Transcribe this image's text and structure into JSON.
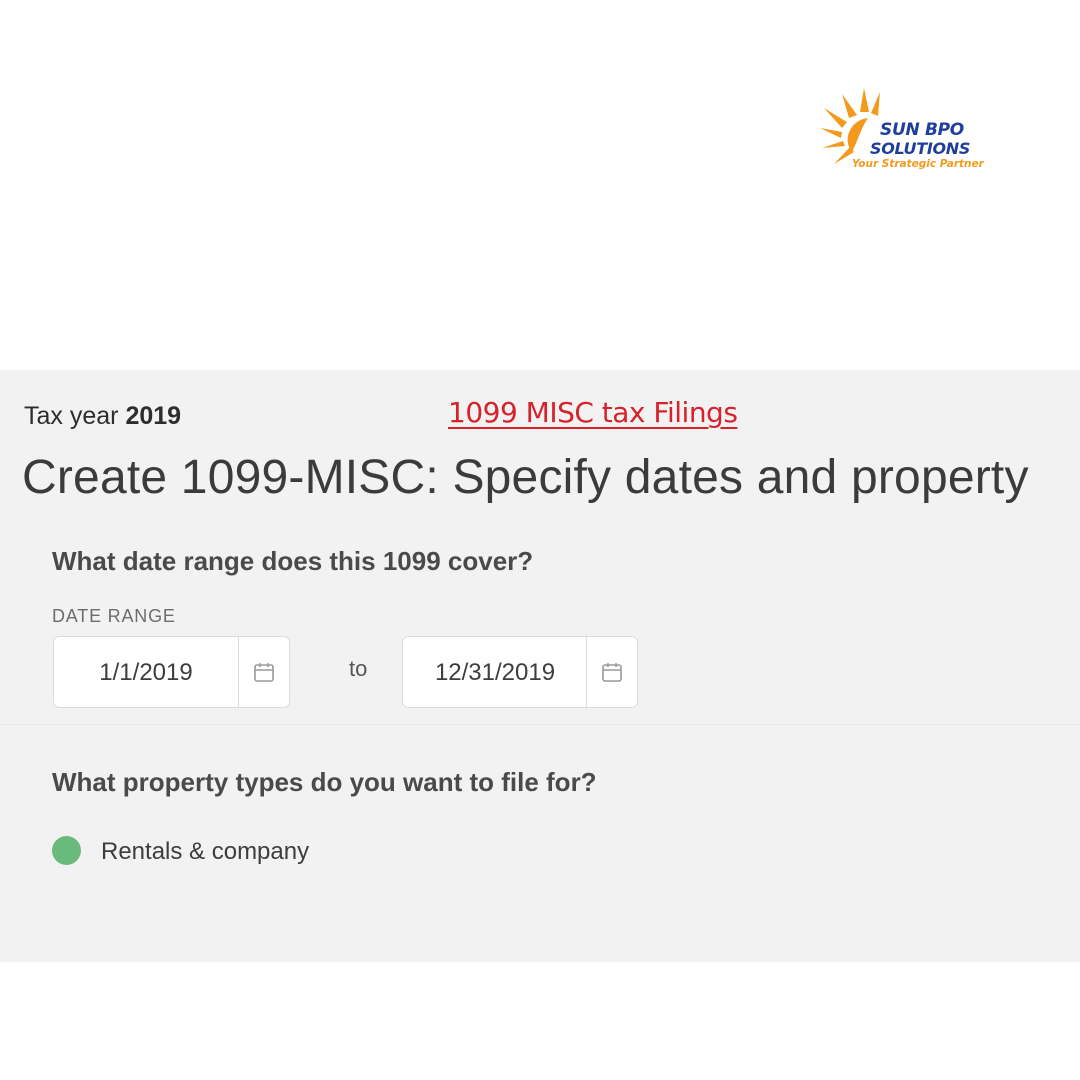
{
  "logo": {
    "line1": "SUN BPO",
    "line2": "SOLUTIONS",
    "tagline": "Your Strategic Partner",
    "colors": {
      "sun": "#f39a1e",
      "text": "#1f3f9a"
    }
  },
  "overlay_title": "1099 MISC tax Filings",
  "header": {
    "tax_year_label": "Tax year",
    "tax_year_value": "2019",
    "page_title": "Create 1099-MISC: Specify dates and property"
  },
  "date_section": {
    "question": "What date range does this 1099 cover?",
    "label": "DATE RANGE",
    "start_value": "1/1/2019",
    "to_label": "to",
    "end_value": "12/31/2019",
    "icon": "calendar-icon"
  },
  "property_section": {
    "question": "What property types do you want to file for?",
    "options": [
      {
        "label": "Rentals & company",
        "selected": true,
        "color": "#6aba7c"
      }
    ]
  },
  "colors": {
    "panel_bg": "#f2f2f2",
    "overlay_title": "#d6222a",
    "selected_radio": "#6aba7c"
  }
}
